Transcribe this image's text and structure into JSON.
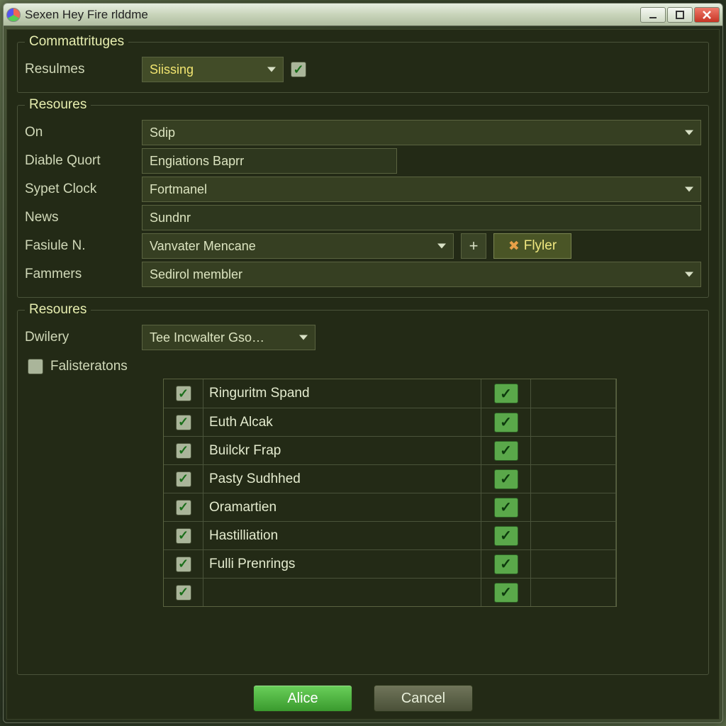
{
  "window": {
    "title": "Sexen Hey Fire rlddme"
  },
  "group1": {
    "legend": "Commattrituges",
    "resulmes_label": "Resulmes",
    "resulmes_value": "Siissing"
  },
  "group2": {
    "legend": "Resoures",
    "on_label": "On",
    "on_value": "Sdip",
    "diable_label": "Diable Quort",
    "diable_value": "Engiations Baprr",
    "sypet_label": "Sypet Clock",
    "sypet_value": "Fortmanel",
    "news_label": "News",
    "news_value": "Sundnr",
    "fasiule_label": "Fasiule N.",
    "fasiule_value": "Vanvater Mencane",
    "flyler_label": "Flyler",
    "fammers_label": "Fammers",
    "fammers_value": "Sedirol membler"
  },
  "group3": {
    "legend": "Resoures",
    "dwilery_label": "Dwilery",
    "dwilery_value": "Tee Incwalter Gso…",
    "falister_label": "Falisteratons",
    "rows": [
      {
        "label": "Ringuritm Spand"
      },
      {
        "label": "Euth Alcak"
      },
      {
        "label": "Builckr Frap"
      },
      {
        "label": "Pasty Sudhhed"
      },
      {
        "label": "Oramartien"
      },
      {
        "label": "Hastilliation"
      },
      {
        "label": "Fulli Prenrings"
      },
      {
        "label": ""
      }
    ]
  },
  "buttons": {
    "ok": "Alice",
    "cancel": "Cancel"
  }
}
